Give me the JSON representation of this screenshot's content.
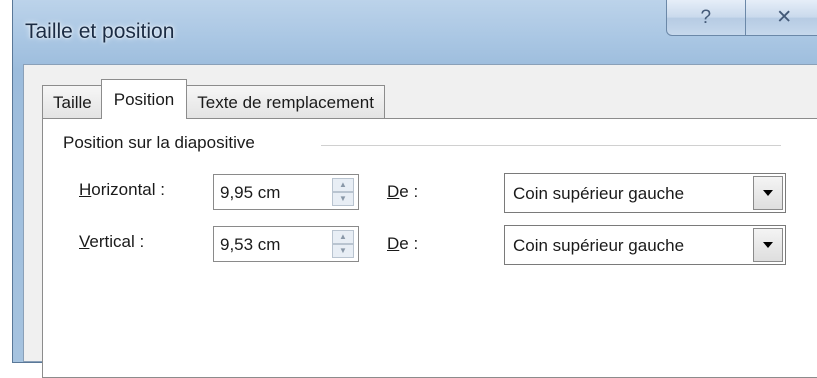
{
  "dialog": {
    "title": "Taille et position",
    "help_glyph": "?",
    "close_glyph": "✕"
  },
  "tabs": [
    {
      "label": "Taille",
      "active": false
    },
    {
      "label": "Position",
      "active": true
    },
    {
      "label": "Texte de remplacement",
      "active": false
    }
  ],
  "group": {
    "label": "Position sur la diapositive"
  },
  "horizontal": {
    "label_first": "H",
    "label_rest": "orizontal :",
    "value": "9,95 cm",
    "de_first": "D",
    "de_rest": "e :",
    "from": "Coin supérieur gauche"
  },
  "vertical": {
    "label_first": "V",
    "label_rest": "ertical :",
    "value": "9,53 cm",
    "de_first": "D",
    "de_rest": "e :",
    "from": "Coin supérieur gauche"
  },
  "icons": {
    "spin_up": "▲",
    "spin_down": "▼"
  }
}
